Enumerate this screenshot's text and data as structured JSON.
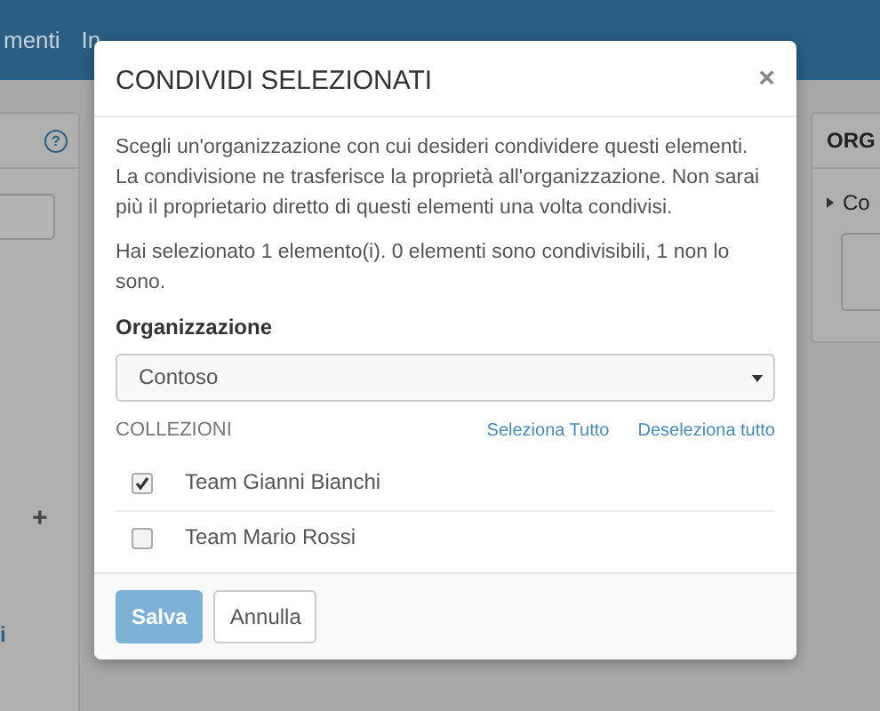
{
  "background": {
    "nav_items": [
      "menti",
      "In"
    ],
    "left_panel": {
      "help": "?",
      "add": "+",
      "cut_label": "i"
    },
    "right_panel": {
      "title": "ORG",
      "item": "Co"
    }
  },
  "dialog": {
    "title": "CONDIVIDI SELEZIONATI",
    "close": "×",
    "description": "Scegli un'organizzazione con cui desideri condividere questi elementi. La condivisione ne trasferisce la proprietà all'organizzazione. Non sarai più il proprietario diretto di questi elementi una volta condivisi.",
    "summary": "Hai selezionato 1 elemento(i). 0 elementi sono condivisibili, 1 non lo sono.",
    "organization": {
      "label": "Organizzazione",
      "value": "Contoso"
    },
    "collections": {
      "heading": "COLLEZIONI",
      "select_all": "Seleziona Tutto",
      "deselect_all": "Deseleziona tutto",
      "items": [
        {
          "name": "Team Gianni Bianchi",
          "checked": true
        },
        {
          "name": "Team Mario Rossi",
          "checked": false
        }
      ]
    },
    "buttons": [
      {
        "label": "Salva",
        "kind": "primary",
        "disabled": true
      },
      {
        "label": "Annulla",
        "kind": "default",
        "disabled": false
      }
    ]
  }
}
